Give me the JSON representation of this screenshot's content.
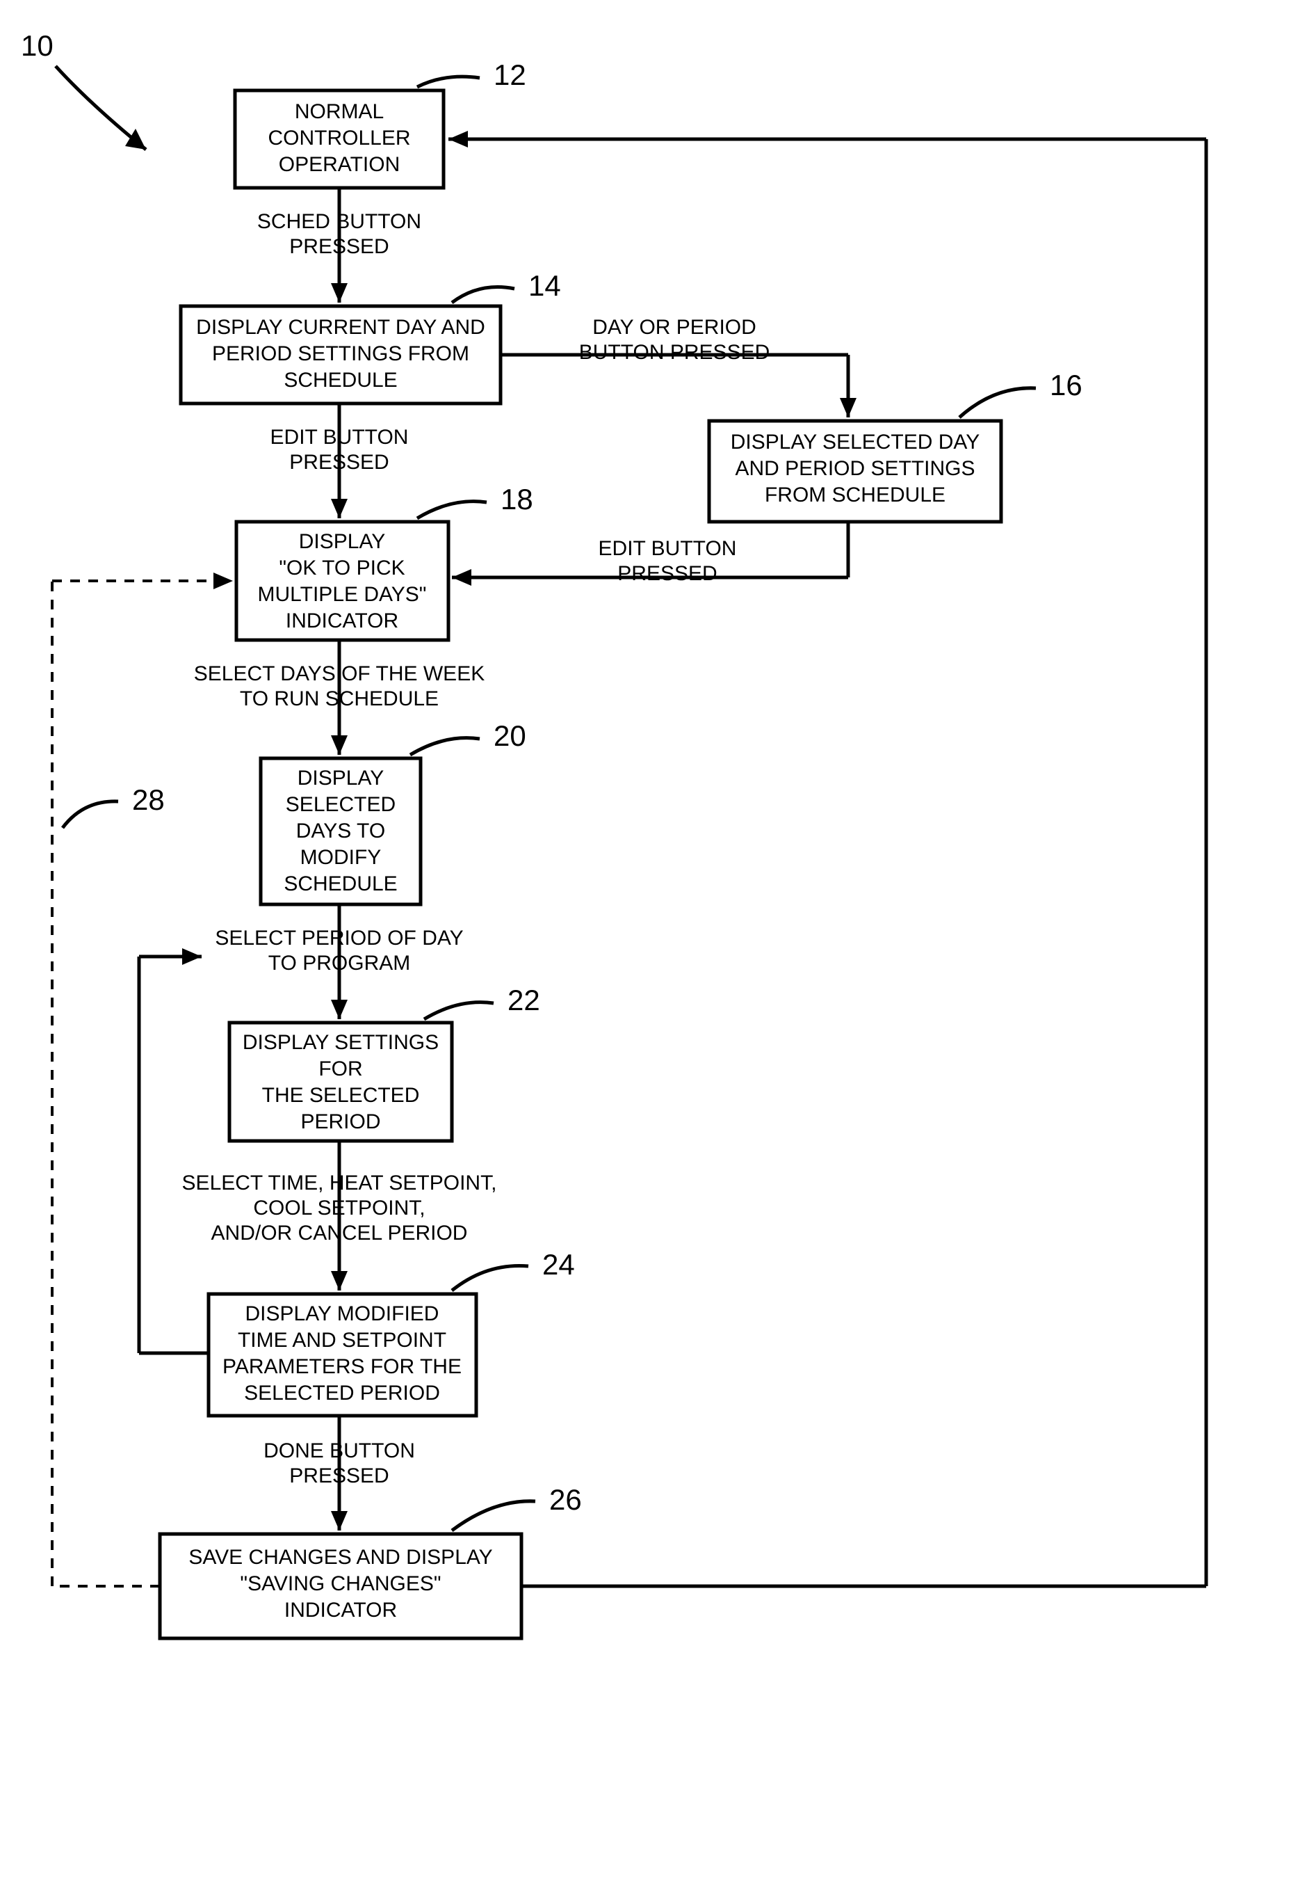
{
  "ref_root": "10",
  "refs": {
    "b12": "12",
    "b14": "14",
    "b16": "16",
    "b18": "18",
    "b20": "20",
    "b22": "22",
    "b24": "24",
    "b26": "26",
    "loop": "28"
  },
  "boxes": {
    "b12": [
      "NORMAL",
      "CONTROLLER",
      "OPERATION"
    ],
    "b14": [
      "DISPLAY CURRENT DAY AND",
      "PERIOD SETTINGS FROM",
      "SCHEDULE"
    ],
    "b16": [
      "DISPLAY SELECTED DAY",
      "AND PERIOD SETTINGS",
      "FROM SCHEDULE"
    ],
    "b18": [
      "DISPLAY",
      "\"OK TO PICK",
      "MULTIPLE DAYS\"",
      "INDICATOR"
    ],
    "b20": [
      "DISPLAY",
      "SELECTED",
      "DAYS TO",
      "MODIFY",
      "SCHEDULE"
    ],
    "b22": [
      "DISPLAY SETTINGS",
      "FOR",
      "THE SELECTED",
      "PERIOD"
    ],
    "b24": [
      "DISPLAY MODIFIED",
      "TIME AND SETPOINT",
      "PARAMETERS FOR THE",
      "SELECTED PERIOD"
    ],
    "b26": [
      "SAVE CHANGES AND DISPLAY",
      "\"SAVING CHANGES\"",
      "INDICATOR"
    ]
  },
  "edges": {
    "e12_14": [
      "SCHED BUTTON",
      "PRESSED"
    ],
    "e14_18": [
      "EDIT BUTTON",
      "PRESSED"
    ],
    "e14_16": [
      "DAY OR PERIOD",
      "BUTTON PRESSED"
    ],
    "e16_18": [
      "EDIT BUTTON",
      "PRESSED"
    ],
    "e18_20": [
      "SELECT DAYS OF THE WEEK",
      "TO RUN SCHEDULE"
    ],
    "e20_22": [
      "SELECT PERIOD OF DAY",
      "TO PROGRAM"
    ],
    "e22_24": [
      "SELECT TIME, HEAT SETPOINT,",
      "COOL SETPOINT,",
      "AND/OR CANCEL PERIOD"
    ],
    "e24_26": [
      "DONE BUTTON",
      "PRESSED"
    ]
  }
}
